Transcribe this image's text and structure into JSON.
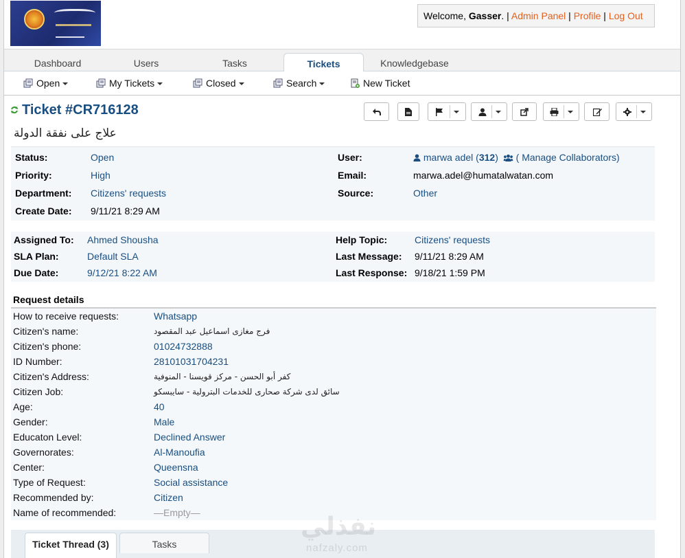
{
  "header": {
    "welcome_prefix": "Welcome, ",
    "username": "Gasser",
    "welcome_suffix": ". | ",
    "admin_panel": "Admin Panel",
    "profile": "Profile",
    "logout": "Log Out",
    "sep": " | "
  },
  "nav": {
    "tabs": [
      "Dashboard",
      "Users",
      "Tasks",
      "Tickets",
      "Knowledgebase"
    ],
    "active": "Tickets"
  },
  "subnav": {
    "open": "Open",
    "my_tickets": "My Tickets",
    "closed": "Closed",
    "search": "Search",
    "new_ticket": "New Ticket"
  },
  "ticket": {
    "title": "Ticket #CR716128",
    "subject": "علاج على نفقة الدولة"
  },
  "info": {
    "status_label": "Status:",
    "status": "Open",
    "priority_label": "Priority:",
    "priority": "High",
    "department_label": "Department:",
    "department": "Citizens' requests",
    "create_date_label": "Create Date:",
    "create_date": "9/11/21 8:29 AM",
    "user_label": "User:",
    "user_name": "marwa adel",
    "user_count": "312",
    "collab_prefix": "( ",
    "collab": "Manage Collaborators)",
    "email_label": "Email:",
    "email": "marwa.adel@humatalwatan.com",
    "source_label": "Source:",
    "source": "Other"
  },
  "assign": {
    "assigned_label": "Assigned To:",
    "assigned": "Ahmed Shousha",
    "sla_label": "SLA Plan:",
    "sla": "Default SLA",
    "due_label": "Due Date:",
    "due": "9/12/21 8:22 AM",
    "help_label": "Help Topic:",
    "help": "Citizens' requests",
    "last_msg_label": "Last Message:",
    "last_msg": "9/11/21 8:29 AM",
    "last_resp_label": "Last Response:",
    "last_resp": "9/18/21 1:59 PM"
  },
  "request": {
    "header": "Request details",
    "rows": [
      {
        "label": "How to receive requests:",
        "value": "Whatsapp"
      },
      {
        "label": "Citizen's name:",
        "value": "فرج مغازى اسماعيل عبد المقصود"
      },
      {
        "label": "Citizen's phone:",
        "value": "01024732888"
      },
      {
        "label": "ID Number:",
        "value": "28101031704231"
      },
      {
        "label": "Citizen's Address:",
        "value": "كفر أبو الحسن - مركز قويسنا - المنوفية"
      },
      {
        "label": "Citizen Job:",
        "value": "سائق لدى شركة صحارى للخدمات البترولية - سايبسكو"
      },
      {
        "label": "Age:",
        "value": "40"
      },
      {
        "label": "Gender:",
        "value": "Male"
      },
      {
        "label": "Educaton Level:",
        "value": "Declined Answer"
      },
      {
        "label": "Governorates:",
        "value": "Al-Manoufia"
      },
      {
        "label": "Center:",
        "value": "Queensna"
      },
      {
        "label": "Type of Request:",
        "value": "Social assistance"
      },
      {
        "label": "Recommended by:",
        "value": "Citizen"
      },
      {
        "label": "Name of recommended:",
        "value": "—Empty—"
      }
    ]
  },
  "bottom_tabs": {
    "thread": "Ticket Thread (3)",
    "tasks": "Tasks"
  },
  "watermark": {
    "arabic": "نفذلي",
    "latin": "nafzaly.com"
  },
  "colors": {
    "link_blue": "#184e81",
    "link_orange": "#e4601d",
    "refresh_green": "#3a9b35"
  }
}
